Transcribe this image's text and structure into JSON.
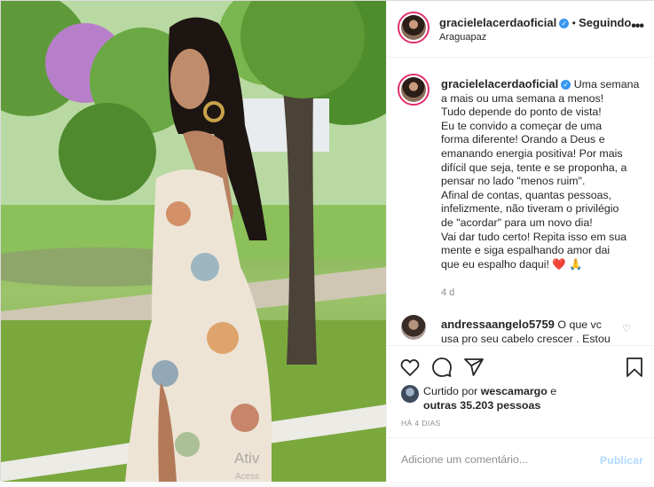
{
  "post": {
    "username": "gracielelacerdaoficial",
    "separator": "•",
    "follow_status": "Seguindo",
    "location": "Araguapaz",
    "more_icon": "more-options-icon"
  },
  "caption": {
    "username": "gracielelacerdaoficial",
    "lines": [
      "Uma semana",
      "a mais ou uma semana a menos!",
      "Tudo depende do ponto de vista!",
      "Eu te convido a começar de uma",
      "forma diferente! Orando a Deus e",
      "emanando energia positiva! Por mais",
      "difícil que seja, tente e se proponha, a",
      "pensar no lado \"menos ruim\".",
      "Afinal de contas, quantas pessoas,",
      "infelizmente, não tiveram o privilégio",
      "de \"acordar\" para um novo dia!",
      "Vai dar tudo certo! Repita isso em sua",
      "mente e siga espalhando amor dai",
      "que eu espalho daqui!"
    ],
    "emoji_heart": "❤️",
    "emoji_pray": "🙏",
    "time": "4 d"
  },
  "comment": {
    "username": "andressaangelo5759",
    "line1": "O que vc",
    "line2": "usa pro seu cabelo crescer . Estou"
  },
  "likes": {
    "prefix": "Curtido por",
    "user": "wescamargo",
    "suffix": "e",
    "others": "outras 35.203 pessoas"
  },
  "date": "HÁ 4 DIAS",
  "add_comment": {
    "placeholder": "Adicione um comentário...",
    "publish_label": "Publicar"
  },
  "watermark": {
    "line1": "Ativ",
    "line2": "Acess"
  },
  "colors": {
    "verified": "#3897f0",
    "link_blue": "#b3dbff",
    "heart": "#e0245e",
    "border": "#dbdbdb"
  }
}
